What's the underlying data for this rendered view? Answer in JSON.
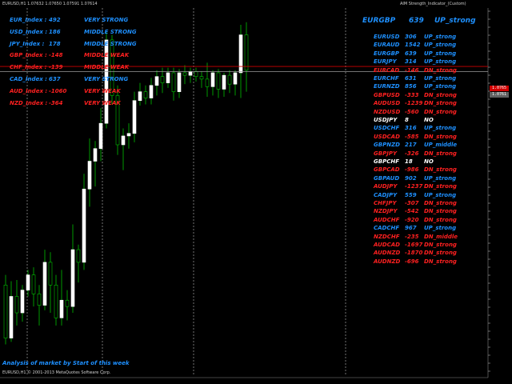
{
  "window": {
    "title_left": "EURUSD,H1 1.07632 1.07650 1.07591 1.07614",
    "title_right": "AIM Strength_Indicator_(Custom)"
  },
  "indices": [
    {
      "label": "EUR_Index :",
      "value": "492",
      "status": "VERY STRONG",
      "color": "#1e90ff"
    },
    {
      "label": "USD_Index :",
      "value": "186",
      "status": "MIDDLE STRONG",
      "color": "#1e90ff"
    },
    {
      "label": "JPY_Index :",
      "value": "178",
      "status": "MIDDLE STRONG",
      "color": "#1e90ff"
    },
    {
      "label": "GBP_Index :",
      "value": "-148",
      "status": "MIDDLE WEAK",
      "color": "#ff2020"
    },
    {
      "label": "CHF_Index :",
      "value": "-139",
      "status": "MIDDLE WEAK",
      "color": "#ff2020"
    },
    {
      "label": "CAD_Index :",
      "value": "637",
      "status": "VERY STRONG",
      "color": "#1e90ff"
    },
    {
      "label": "AUD_Index :",
      "value": "-1060",
      "status": "VERY WEAK",
      "color": "#ff2020"
    },
    {
      "label": "NZD_Index :",
      "value": "-364",
      "status": "VERY WEAK",
      "color": "#ff2020"
    }
  ],
  "headline": {
    "pair": "EURGBP",
    "value": "639",
    "status": "UP_strong"
  },
  "pairs": [
    {
      "pair": "EURUSD",
      "value": "306",
      "status": "UP_strong",
      "color": "#1e90ff"
    },
    {
      "pair": "EURAUD",
      "value": "1542",
      "status": "UP_strong",
      "color": "#1e90ff"
    },
    {
      "pair": "EURGBP",
      "value": "639",
      "status": "UP_strong",
      "color": "#1e90ff"
    },
    {
      "pair": "EURJPY",
      "value": "314",
      "status": "UP_strong",
      "color": "#1e90ff"
    },
    {
      "pair": "EURCAD",
      "value": "-146",
      "status": "DN_strong",
      "color": "#ff2020"
    },
    {
      "pair": "EURCHF",
      "value": "631",
      "status": "UP_strong",
      "color": "#1e90ff"
    },
    {
      "pair": "EURNZD",
      "value": "856",
      "status": "UP_strong",
      "color": "#1e90ff"
    },
    {
      "pair": "GBPUSD",
      "value": "-333",
      "status": "DN_strong",
      "color": "#ff2020"
    },
    {
      "pair": "AUDUSD",
      "value": "-1239",
      "status": "DN_strong",
      "color": "#ff2020"
    },
    {
      "pair": "NZDUSD",
      "value": "-560",
      "status": "DN_strong",
      "color": "#ff2020"
    },
    {
      "pair": "USDJPY",
      "value": "8",
      "status": "NO",
      "color": "#ffffff"
    },
    {
      "pair": "USDCHF",
      "value": "316",
      "status": "UP_strong",
      "color": "#1e90ff"
    },
    {
      "pair": "USDCAD",
      "value": "-585",
      "status": "DN_strong",
      "color": "#ff2020"
    },
    {
      "pair": "GBPNZD",
      "value": "217",
      "status": "UP_middle",
      "color": "#1e90ff"
    },
    {
      "pair": "GBPJPY",
      "value": "-326",
      "status": "DN_strong",
      "color": "#ff2020"
    },
    {
      "pair": "GBPCHF",
      "value": "18",
      "status": "NO",
      "color": "#ffffff"
    },
    {
      "pair": "GBPCAD",
      "value": "-986",
      "status": "DN_strong",
      "color": "#ff2020"
    },
    {
      "pair": "GBPAUD",
      "value": "902",
      "status": "UP_strong",
      "color": "#1e90ff"
    },
    {
      "pair": "AUDJPY",
      "value": "-1237",
      "status": "DN_strong",
      "color": "#ff2020"
    },
    {
      "pair": "CADJPY",
      "value": "559",
      "status": "UP_strong",
      "color": "#1e90ff"
    },
    {
      "pair": "CHFJPY",
      "value": "-307",
      "status": "DN_strong",
      "color": "#ff2020"
    },
    {
      "pair": "NZDJPY",
      "value": "-542",
      "status": "DN_strong",
      "color": "#ff2020"
    },
    {
      "pair": "AUDCHF",
      "value": "-920",
      "status": "DN_strong",
      "color": "#ff2020"
    },
    {
      "pair": "CADCHF",
      "value": "967",
      "status": "UP_strong",
      "color": "#1e90ff"
    },
    {
      "pair": "NZDCHF",
      "value": "-235",
      "status": "DN_middle",
      "color": "#ff2020"
    },
    {
      "pair": "AUDCAD",
      "value": "-1697",
      "status": "DN_strong",
      "color": "#ff2020"
    },
    {
      "pair": "AUDNZD",
      "value": "-1870",
      "status": "DN_strong",
      "color": "#ff2020"
    },
    {
      "pair": "AUDNZD",
      "value": "-696",
      "status": "DN_strong",
      "color": "#ff2020"
    }
  ],
  "footer": {
    "analysis_note": "Analysis of market by Start of this week",
    "copyright": "EURUSD,H1 © 2001-2013 MetaQuotes Software Corp."
  },
  "price_tags": [
    {
      "label": "1.0765",
      "color": "#d00000"
    },
    {
      "label": "1.0761",
      "color": "#606060"
    }
  ],
  "colors": {
    "background": "#000000",
    "bull_candle": "#ffffff",
    "bear_candle": "#000000",
    "wick": "#00c000",
    "grid": "#ffffff",
    "positive": "#1e90ff",
    "negative": "#ff2020"
  },
  "chart_data": {
    "type": "candlestick",
    "candles": [
      {
        "o": 1.0592,
        "h": 1.06,
        "l": 1.0545,
        "c": 1.055
      },
      {
        "o": 1.055,
        "h": 1.0595,
        "l": 1.0547,
        "c": 1.0583
      },
      {
        "o": 1.0583,
        "h": 1.0596,
        "l": 1.056,
        "c": 1.057
      },
      {
        "o": 1.057,
        "h": 1.0592,
        "l": 1.0563,
        "c": 1.0588
      },
      {
        "o": 1.0588,
        "h": 1.0604,
        "l": 1.0583,
        "c": 1.06
      },
      {
        "o": 1.06,
        "h": 1.0606,
        "l": 1.0575,
        "c": 1.0585
      },
      {
        "o": 1.0585,
        "h": 1.0592,
        "l": 1.056,
        "c": 1.0576
      },
      {
        "o": 1.0576,
        "h": 1.062,
        "l": 1.0572,
        "c": 1.061
      },
      {
        "o": 1.061,
        "h": 1.0618,
        "l": 1.057,
        "c": 1.0592
      },
      {
        "o": 1.0592,
        "h": 1.06,
        "l": 1.056,
        "c": 1.0566
      },
      {
        "o": 1.0566,
        "h": 1.0604,
        "l": 1.056,
        "c": 1.058
      },
      {
        "o": 1.058,
        "h": 1.0588,
        "l": 1.0564,
        "c": 1.0575
      },
      {
        "o": 1.0575,
        "h": 1.064,
        "l": 1.057,
        "c": 1.062
      },
      {
        "o": 1.062,
        "h": 1.0624,
        "l": 1.0594,
        "c": 1.061
      },
      {
        "o": 1.061,
        "h": 1.068,
        "l": 1.0604,
        "c": 1.0668
      },
      {
        "o": 1.0668,
        "h": 1.0708,
        "l": 1.0654,
        "c": 1.069
      },
      {
        "o": 1.069,
        "h": 1.0706,
        "l": 1.067,
        "c": 1.07
      },
      {
        "o": 1.07,
        "h": 1.0732,
        "l": 1.069,
        "c": 1.072
      },
      {
        "o": 1.072,
        "h": 1.0792,
        "l": 1.0716,
        "c": 1.0786
      },
      {
        "o": 1.0786,
        "h": 1.079,
        "l": 1.0735,
        "c": 1.0742
      },
      {
        "o": 1.0742,
        "h": 1.075,
        "l": 1.0695,
        "c": 1.0703
      },
      {
        "o": 1.0703,
        "h": 1.0716,
        "l": 1.0683,
        "c": 1.071
      },
      {
        "o": 1.071,
        "h": 1.072,
        "l": 1.07,
        "c": 1.0712
      },
      {
        "o": 1.0712,
        "h": 1.0745,
        "l": 1.0705,
        "c": 1.0738
      },
      {
        "o": 1.0738,
        "h": 1.0752,
        "l": 1.0734,
        "c": 1.0745
      },
      {
        "o": 1.0745,
        "h": 1.075,
        "l": 1.0735,
        "c": 1.074
      },
      {
        "o": 1.074,
        "h": 1.0756,
        "l": 1.0735,
        "c": 1.075
      },
      {
        "o": 1.075,
        "h": 1.0762,
        "l": 1.0742,
        "c": 1.0757
      },
      {
        "o": 1.0757,
        "h": 1.0764,
        "l": 1.0744,
        "c": 1.0752
      },
      {
        "o": 1.0752,
        "h": 1.0764,
        "l": 1.0748,
        "c": 1.076
      },
      {
        "o": 1.076,
        "h": 1.0764,
        "l": 1.0738,
        "c": 1.0745
      },
      {
        "o": 1.0745,
        "h": 1.0763,
        "l": 1.074,
        "c": 1.076
      },
      {
        "o": 1.076,
        "h": 1.0766,
        "l": 1.0751,
        "c": 1.0758
      },
      {
        "o": 1.0758,
        "h": 1.0764,
        "l": 1.0752,
        "c": 1.0761
      },
      {
        "o": 1.0761,
        "h": 1.0764,
        "l": 1.0753,
        "c": 1.0757
      },
      {
        "o": 1.0757,
        "h": 1.0761,
        "l": 1.0748,
        "c": 1.0755
      },
      {
        "o": 1.0755,
        "h": 1.0768,
        "l": 1.0741,
        "c": 1.0749
      },
      {
        "o": 1.0749,
        "h": 1.0762,
        "l": 1.0742,
        "c": 1.076
      },
      {
        "o": 1.076,
        "h": 1.0763,
        "l": 1.074,
        "c": 1.0747
      },
      {
        "o": 1.0747,
        "h": 1.076,
        "l": 1.0741,
        "c": 1.0758
      },
      {
        "o": 1.0758,
        "h": 1.0762,
        "l": 1.0744,
        "c": 1.0751
      },
      {
        "o": 1.0751,
        "h": 1.0762,
        "l": 1.0742,
        "c": 1.076
      },
      {
        "o": 1.076,
        "h": 1.0798,
        "l": 1.074,
        "c": 1.079
      },
      {
        "o": 1.079,
        "h": 1.08,
        "l": 1.0745,
        "c": 1.0762
      }
    ],
    "price_levels": [
      1.0765,
      1.0761
    ],
    "ylim": [
      1.052,
      1.081
    ]
  }
}
